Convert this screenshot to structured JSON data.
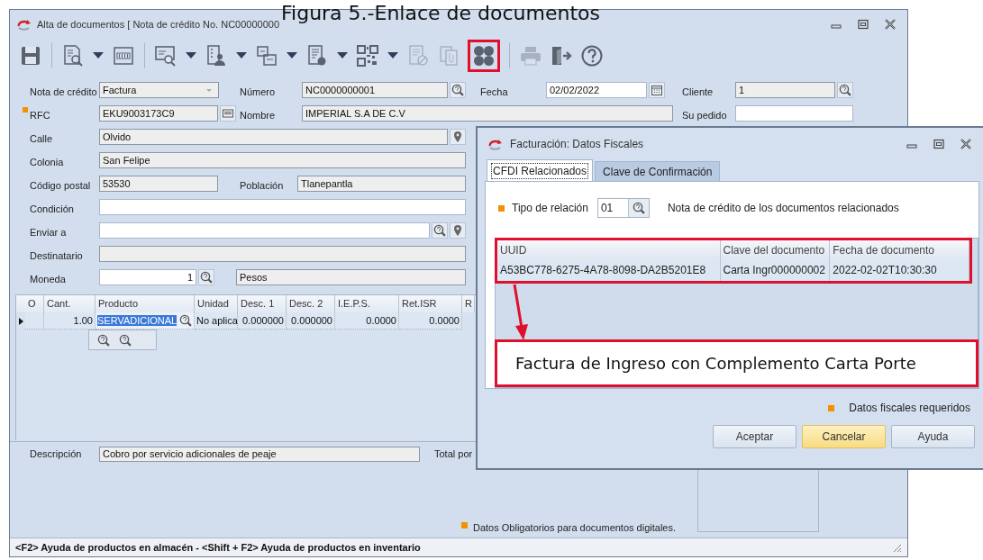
{
  "caption": "Figura 5.-Enlace de documentos",
  "main_window": {
    "title": "Alta de documentos [ Nota de crédito No. NC00000000",
    "toolbar": [
      [
        {
          "kind": "save",
          "disabled": false,
          "marked": false
        }
      ],
      [
        {
          "kind": "doc-search",
          "disabled": false,
          "marked": false
        },
        {
          "kind": "dropdown",
          "disabled": false,
          "marked": false
        },
        {
          "kind": "numbered",
          "disabled": false,
          "marked": false
        }
      ],
      [
        {
          "kind": "screen-search",
          "disabled": false,
          "marked": false
        },
        {
          "kind": "dropdown",
          "disabled": false,
          "marked": false
        },
        {
          "kind": "user-doc",
          "disabled": false,
          "marked": false
        },
        {
          "kind": "dropdown",
          "disabled": false,
          "marked": false
        },
        {
          "kind": "boxes",
          "disabled": false,
          "marked": false
        },
        {
          "kind": "dropdown",
          "disabled": false,
          "marked": false
        },
        {
          "kind": "doc-disc",
          "disabled": false,
          "marked": false
        },
        {
          "kind": "dropdown",
          "disabled": false,
          "marked": false
        },
        {
          "kind": "qr",
          "disabled": false,
          "marked": false
        },
        {
          "kind": "dropdown",
          "disabled": false,
          "marked": false
        },
        {
          "kind": "doc-cancel",
          "disabled": true,
          "marked": false
        },
        {
          "kind": "doc-clip",
          "disabled": true,
          "marked": false
        },
        {
          "kind": "four-dots",
          "disabled": false,
          "marked": true
        }
      ],
      [
        {
          "kind": "printer",
          "disabled": true,
          "marked": false
        },
        {
          "kind": "exit",
          "disabled": false,
          "marked": false
        },
        {
          "kind": "help",
          "disabled": false,
          "marked": false
        }
      ]
    ],
    "form_rows": [
      {
        "items": [
          {
            "kind": "label",
            "text": "Nota de crédito",
            "required": false
          },
          {
            "kind": "dropdown",
            "value": "Factura",
            "editable": false
          },
          {
            "kind": "label",
            "text": "Número",
            "required": false
          },
          {
            "kind": "field",
            "value": "NC0000000001",
            "editable": false,
            "buttons": [
              {
                "kind": "search"
              }
            ]
          },
          {
            "kind": "label",
            "text": "Fecha",
            "required": false
          },
          {
            "kind": "field",
            "value": "02/02/2022",
            "editable": true,
            "buttons": [
              {
                "kind": "calendar"
              }
            ]
          },
          {
            "kind": "label",
            "text": "Cliente",
            "required": false
          },
          {
            "kind": "field",
            "value": "1",
            "editable": false,
            "buttons": [
              {
                "kind": "search"
              }
            ]
          }
        ]
      },
      {
        "items": [
          {
            "kind": "label",
            "text": "RFC",
            "required": true
          },
          {
            "kind": "field",
            "value": "EKU9003173C9",
            "editable": false,
            "buttons": [
              {
                "kind": "card"
              }
            ]
          },
          {
            "kind": "label",
            "text": "Nombre",
            "required": false
          },
          {
            "kind": "field",
            "value": "IMPERIAL S.A DE C.V",
            "editable": false
          },
          {
            "kind": "label",
            "text": "Su pedido",
            "required": false
          },
          {
            "kind": "field",
            "editable": true
          }
        ]
      },
      {
        "items": [
          {
            "kind": "label",
            "text": "Calle",
            "required": false
          },
          {
            "kind": "field",
            "value": "Olvido",
            "editable": false,
            "buttons": [
              {
                "kind": "pin"
              }
            ]
          }
        ]
      },
      {
        "items": [
          {
            "kind": "label",
            "text": "Colonia",
            "required": false
          },
          {
            "kind": "field",
            "value": "San Felipe",
            "editable": false
          }
        ]
      },
      {
        "items": [
          {
            "kind": "label",
            "text": "Código postal",
            "required": false
          },
          {
            "kind": "field",
            "value": "53530",
            "editable": false
          },
          {
            "kind": "label",
            "text": "Población",
            "required": false
          },
          {
            "kind": "field",
            "value": "Tlanepantla",
            "editable": false
          }
        ]
      },
      {
        "items": [
          {
            "kind": "label",
            "text": "Condición",
            "required": false
          },
          {
            "kind": "field",
            "editable": true
          }
        ]
      },
      {
        "items": [
          {
            "kind": "label",
            "text": "Enviar a",
            "required": false
          },
          {
            "kind": "field",
            "editable": true,
            "buttons": [
              {
                "kind": "search"
              },
              {
                "kind": "pin"
              }
            ]
          }
        ]
      },
      {
        "items": [
          {
            "kind": "label",
            "text": "Destinatario",
            "required": false
          },
          {
            "kind": "field",
            "editable": false
          }
        ]
      },
      {
        "items": [
          {
            "kind": "label",
            "text": "Moneda",
            "required": false
          },
          {
            "kind": "number",
            "value": "1",
            "editable": true,
            "buttons": [
              {
                "kind": "search"
              }
            ]
          },
          {
            "kind": "field",
            "value": "Pesos",
            "editable": false
          }
        ]
      }
    ],
    "items_table": {
      "columns": [
        "O",
        "Cant.",
        "Producto",
        "Unidad",
        "Desc. 1",
        "Desc. 2",
        "I.E.P.S.",
        "Ret.ISR",
        "R"
      ],
      "rows": [
        {
          "current": true,
          "cells": [
            {
              "text": "",
              "selected": false
            },
            {
              "text": "1.00",
              "selected": false
            },
            {
              "text": "SERVADICIONAL",
              "selected": true,
              "buttons": [
                {
                  "kind": "search"
                }
              ]
            },
            {
              "text": "No aplica",
              "selected": false
            },
            {
              "text": "0.000000",
              "selected": false
            },
            {
              "text": "0.000000",
              "selected": false
            },
            {
              "text": "0.0000",
              "selected": false
            },
            {
              "text": "0.0000",
              "selected": false
            }
          ]
        }
      ],
      "lookup_buttons": [
        {
          "kind": "search"
        },
        {
          "kind": "search"
        }
      ]
    },
    "description": {
      "label": "Descripción",
      "value": "Cobro por servicio adicionales de peaje",
      "editable": false
    },
    "total_label": "Total por",
    "required_note": "Datos Obligatorios para documentos digitales.",
    "status_bar": "<F2> Ayuda de productos en almacén - <Shift + F2> Ayuda de productos en inventario"
  },
  "dialog": {
    "title": "Facturación: Datos Fiscales",
    "tabs": [
      {
        "label": "CFDI Relacionados",
        "selected": true
      },
      {
        "label": "Clave de Confirmación",
        "selected": false
      }
    ],
    "relation": {
      "label": "Tipo de relación",
      "required": true,
      "value": "01",
      "description": "Nota de crédito de los documentos relacionados"
    },
    "related_table": {
      "marked": true,
      "columns": [
        "UUID",
        "Clave del documento",
        "Fecha de documento"
      ],
      "rows": [
        {
          "cells": [
            "A53BC778-6275-4A78-8098-DA2B5201E8",
            "Carta Ingr000000002",
            "2022-02-02T10:30:30"
          ]
        }
      ]
    },
    "callout": "Factura de Ingreso con Complemento Carta Porte",
    "required_note": "Datos fiscales requeridos",
    "buttons": [
      {
        "label": "Aceptar",
        "focused": false
      },
      {
        "label": "Cancelar",
        "focused": true
      },
      {
        "label": "Ayuda",
        "focused": false
      }
    ]
  }
}
